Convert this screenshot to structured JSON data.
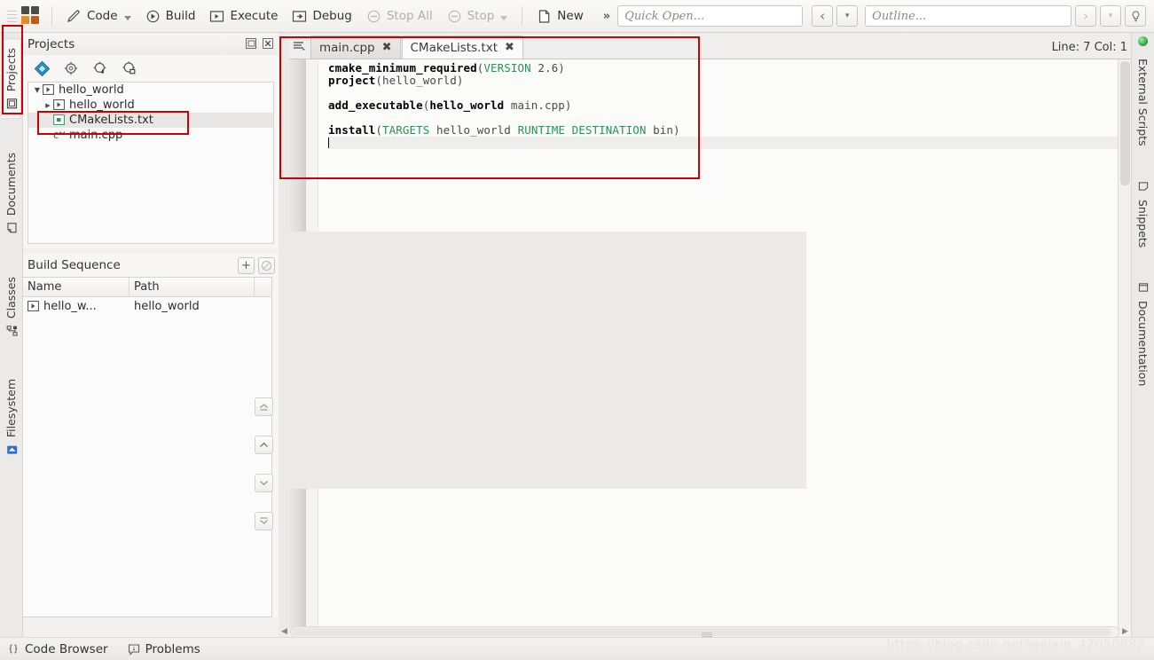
{
  "toolbar": {
    "items": [
      {
        "label": "Code",
        "icon": "pencil-icon",
        "caret": true,
        "disabled": false
      },
      {
        "label": "Build",
        "icon": "build-gear-icon",
        "caret": false,
        "disabled": false
      },
      {
        "label": "Execute",
        "icon": "execute-icon",
        "caret": false,
        "disabled": false
      },
      {
        "label": "Debug",
        "icon": "debug-icon",
        "caret": false,
        "disabled": false
      },
      {
        "label": "Stop All",
        "icon": "stop-icon",
        "caret": false,
        "disabled": true
      },
      {
        "label": "Stop",
        "icon": "stop-icon",
        "caret": true,
        "disabled": true
      },
      {
        "label": "New",
        "icon": "new-file-icon",
        "caret": false,
        "disabled": false
      }
    ],
    "overflow_chevron": "»",
    "quick_open_placeholder": "Quick Open...",
    "outline_placeholder": "Outline...",
    "nav_back": "‹",
    "nav_back_caret": "▾",
    "nav_forward": "›",
    "nav_forward_caret": "▾",
    "hint_icon": "bulb-icon"
  },
  "left_tabs": [
    {
      "label": "Projects",
      "icon": "projects-icon",
      "active": true
    },
    {
      "label": "Documents",
      "icon": "documents-icon",
      "active": false
    },
    {
      "label": "Classes",
      "icon": "classes-icon",
      "active": false
    },
    {
      "label": "Filesystem",
      "icon": "filesystem-icon",
      "active": false
    }
  ],
  "right_tabs": [
    {
      "label": "External Scripts",
      "icon": "green-dot-icon"
    },
    {
      "label": "Snippets",
      "icon": "snippet-icon"
    },
    {
      "label": "Documentation",
      "icon": "documentation-icon"
    }
  ],
  "projects_panel": {
    "title": "Projects",
    "undock_label": "⧉",
    "close_label": "✖",
    "toolbar_icons": [
      "project-diamond-icon",
      "gear-icon",
      "gear-download-icon",
      "gear-add-icon"
    ],
    "tree": [
      {
        "label": "hello_world",
        "depth": 0,
        "expander": "▼",
        "icon": "project-icon",
        "selected": false
      },
      {
        "label": "hello_world",
        "depth": 1,
        "expander": "▶",
        "icon": "target-icon",
        "selected": false
      },
      {
        "label": "CMakeLists.txt",
        "depth": 2,
        "expander": "",
        "icon": "cmake-file-icon",
        "selected": true
      },
      {
        "label": "main.cpp",
        "depth": 2,
        "expander": "",
        "icon": "cpp-file-icon",
        "selected": false
      }
    ]
  },
  "build_sequence": {
    "title": "Build Sequence",
    "add_label": "+",
    "remove_label": "⃠",
    "columns": [
      "Name",
      "Path"
    ],
    "rows": [
      {
        "name": "hello_w...",
        "path": "hello_world",
        "icon": "target-icon"
      }
    ]
  },
  "nav_buttons": [
    {
      "name": "move-to-top-button",
      "glyph": "top"
    },
    {
      "name": "move-up-button",
      "glyph": "up"
    },
    {
      "name": "move-down-button",
      "glyph": "down"
    },
    {
      "name": "move-to-bottom-button",
      "glyph": "bottom"
    }
  ],
  "editor": {
    "tabs": [
      {
        "label": "main.cpp",
        "active": false,
        "close": "✖"
      },
      {
        "label": "CMakeLists.txt",
        "active": true,
        "close": "✖"
      }
    ],
    "tab_menu_icon": "tab-list-icon",
    "line_info": "Line: 7 Col: 1",
    "code_lines": [
      [
        {
          "t": "cmake_minimum_required",
          "c": "kw"
        },
        {
          "t": "(",
          "c": "pl"
        },
        {
          "t": "VERSION",
          "c": "arg"
        },
        {
          "t": " 2.6)",
          "c": "num"
        }
      ],
      [
        {
          "t": "project",
          "c": "kw"
        },
        {
          "t": "(hello_world)",
          "c": "pl"
        }
      ],
      [],
      [
        {
          "t": "add_executable",
          "c": "kw"
        },
        {
          "t": "(",
          "c": "pl"
        },
        {
          "t": "hello_world",
          "c": "ident"
        },
        {
          "t": " main.cpp)",
          "c": "pl"
        }
      ],
      [],
      [
        {
          "t": "install",
          "c": "kw"
        },
        {
          "t": "(",
          "c": "pl"
        },
        {
          "t": "TARGETS",
          "c": "arg"
        },
        {
          "t": " hello_world ",
          "c": "pl"
        },
        {
          "t": "RUNTIME DESTINATION",
          "c": "arg"
        },
        {
          "t": " bin)",
          "c": "pl"
        }
      ],
      []
    ]
  },
  "statusbar": {
    "items": [
      {
        "label": "Code Browser",
        "icon": "braces-icon"
      },
      {
        "label": "Problems",
        "icon": "info-box-icon"
      }
    ]
  },
  "watermark": "https://blog.csdn.net/weixin_42050882",
  "colors": {
    "annotation": "#cc0000",
    "keyword": "#000000",
    "argument": "#2f8f5b",
    "accent_orange": "#e58a2f",
    "panel_bg": "#f7f6f5"
  }
}
